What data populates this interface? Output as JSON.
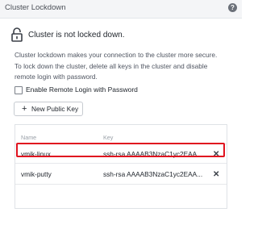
{
  "header": {
    "title": "Cluster Lockdown",
    "help_icon": "?"
  },
  "status": {
    "icon": "unlocked-padlock-icon",
    "text": "Cluster is not locked down."
  },
  "description": {
    "line1": "Cluster lockdown makes your connection to the cluster more secure.",
    "line2": "To lock down the cluster, delete all keys in the cluster and disable",
    "line3": "remote login with password."
  },
  "remote_login": {
    "label": "Enable Remote Login with Password",
    "checked": false
  },
  "new_key_button": {
    "icon": "+",
    "label": "New Public Key"
  },
  "keys_table": {
    "columns": [
      "Name",
      "Key"
    ],
    "rows": [
      {
        "name": "vmik-linux",
        "key": "ssh-rsa AAAAB3NzaC1yc2EAA...",
        "delete": "✕",
        "highlighted": false
      },
      {
        "name": "vmik-putty",
        "key": "ssh-rsa AAAAB3NzaC1yc2EAA...",
        "delete": "✕",
        "highlighted": true
      }
    ]
  },
  "colors": {
    "highlight": "#e0121f",
    "header_bg": "#f4f5f7"
  }
}
